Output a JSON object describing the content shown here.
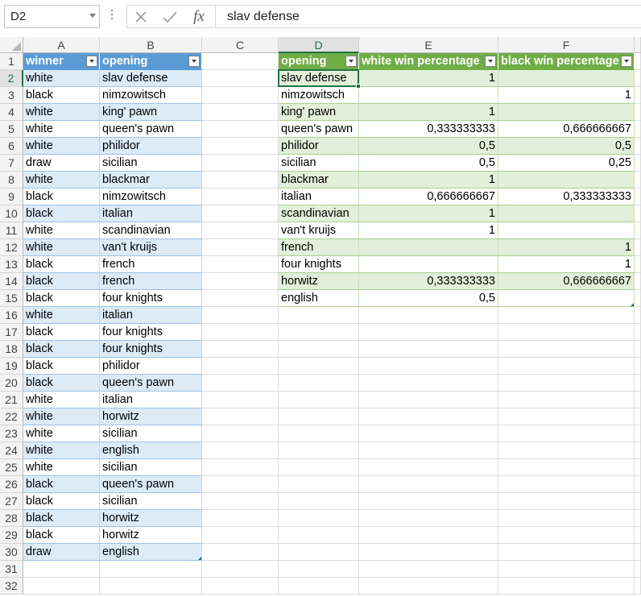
{
  "formula_bar": {
    "name_box": "D2",
    "fx_label": "fx",
    "formula": "slav defense"
  },
  "columns": [
    "A",
    "B",
    "C",
    "D",
    "E",
    "F"
  ],
  "rows": [
    "1",
    "2",
    "3",
    "4",
    "5",
    "6",
    "7",
    "8",
    "9",
    "10",
    "11",
    "12",
    "13",
    "14",
    "15",
    "16",
    "17",
    "18",
    "19",
    "20",
    "21",
    "22",
    "23",
    "24",
    "25",
    "26",
    "27",
    "28",
    "29",
    "30",
    "31",
    "32"
  ],
  "active_cell": "D2",
  "table1": {
    "style_color": "#5b9bd5",
    "headers": [
      "winner",
      "opening"
    ],
    "rows": [
      [
        "white",
        "slav defense"
      ],
      [
        "black",
        "nimzowitsch"
      ],
      [
        "white",
        "king' pawn"
      ],
      [
        "white",
        "queen's pawn"
      ],
      [
        "white",
        "philidor"
      ],
      [
        "draw",
        "sicilian"
      ],
      [
        "white",
        "blackmar"
      ],
      [
        "black",
        "nimzowitsch"
      ],
      [
        "black",
        "italian"
      ],
      [
        "white",
        "scandinavian"
      ],
      [
        "white",
        "van't kruijs"
      ],
      [
        "black",
        "french"
      ],
      [
        "black",
        "french"
      ],
      [
        "black",
        "four knights"
      ],
      [
        "white",
        "italian"
      ],
      [
        "black",
        "four knights"
      ],
      [
        "black",
        "four knights"
      ],
      [
        "black",
        "philidor"
      ],
      [
        "black",
        "queen's pawn"
      ],
      [
        "white",
        "italian"
      ],
      [
        "white",
        "horwitz"
      ],
      [
        "white",
        "sicilian"
      ],
      [
        "white",
        "english"
      ],
      [
        "white",
        "sicilian"
      ],
      [
        "black",
        "queen's pawn"
      ],
      [
        "black",
        "sicilian"
      ],
      [
        "black",
        "horwitz"
      ],
      [
        "black",
        "horwitz"
      ],
      [
        "draw",
        "english"
      ]
    ]
  },
  "table2": {
    "style_color": "#70ad47",
    "headers": [
      "opening",
      "white win percentage",
      "black win percentage"
    ],
    "rows": [
      [
        "slav defense",
        "1",
        ""
      ],
      [
        "nimzowitsch",
        "",
        "1"
      ],
      [
        "king' pawn",
        "1",
        ""
      ],
      [
        "queen's pawn",
        "0,333333333",
        "0,666666667"
      ],
      [
        "philidor",
        "0,5",
        "0,5"
      ],
      [
        "sicilian",
        "0,5",
        "0,25"
      ],
      [
        "blackmar",
        "1",
        ""
      ],
      [
        "italian",
        "0,666666667",
        "0,333333333"
      ],
      [
        "scandinavian",
        "1",
        ""
      ],
      [
        "van't kruijs",
        "1",
        ""
      ],
      [
        "french",
        "",
        "1"
      ],
      [
        "four knights",
        "",
        "1"
      ],
      [
        "horwitz",
        "0,333333333",
        "0,666666667"
      ],
      [
        "english",
        "0,5",
        ""
      ]
    ]
  },
  "colors": {
    "excel_green": "#217346",
    "table1_header": "#5b9bd5",
    "table1_band": "#ddebf7",
    "table2_header": "#70ad47",
    "table2_band": "#e2efda"
  }
}
